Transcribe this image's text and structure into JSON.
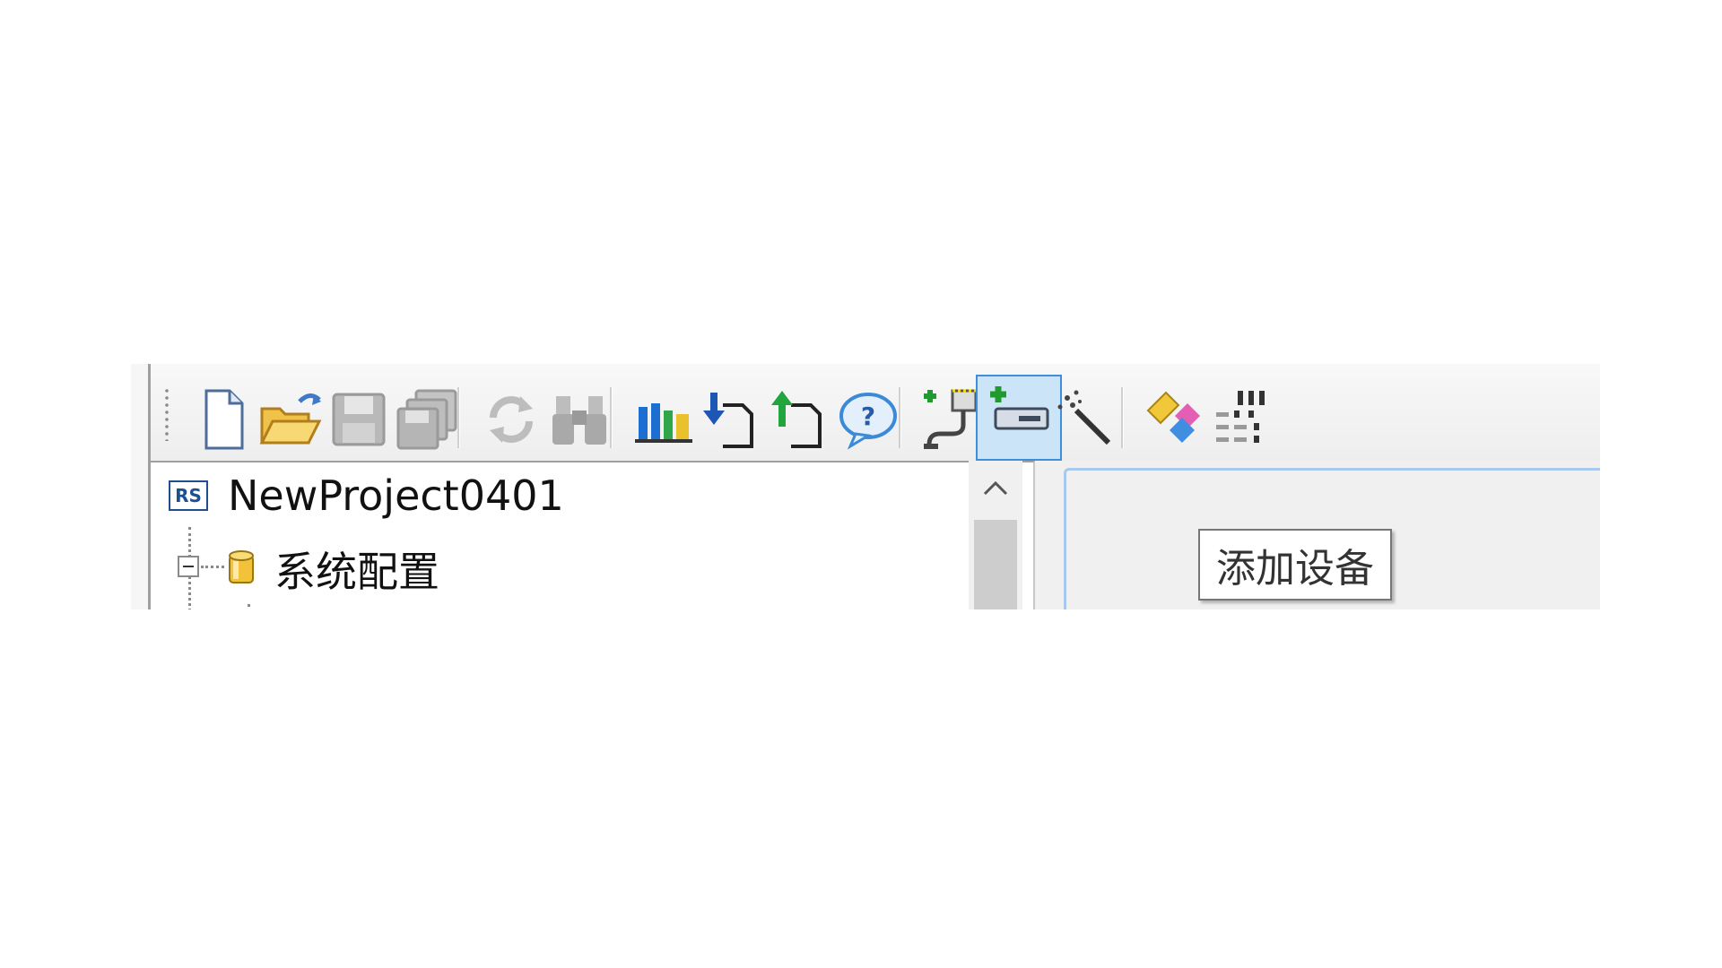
{
  "toolbar": {
    "buttons": [
      {
        "icon": "new-document-icon",
        "state": "enabled"
      },
      {
        "icon": "open-folder-icon",
        "state": "enabled"
      },
      {
        "icon": "save-icon",
        "state": "disabled"
      },
      {
        "icon": "save-all-icon",
        "state": "disabled"
      },
      {
        "icon": "refresh-icon",
        "state": "disabled"
      },
      {
        "icon": "find-binoculars-icon",
        "state": "disabled"
      },
      {
        "icon": "bar-chart-icon",
        "state": "enabled"
      },
      {
        "icon": "download-icon",
        "state": "enabled"
      },
      {
        "icon": "upload-icon",
        "state": "enabled"
      },
      {
        "icon": "help-icon",
        "state": "enabled"
      },
      {
        "icon": "add-connection-icon",
        "state": "enabled"
      },
      {
        "icon": "add-device-icon",
        "state": "hover"
      },
      {
        "icon": "wizard-wand-icon",
        "state": "enabled"
      },
      {
        "icon": "tag-diamond-icon",
        "state": "enabled"
      },
      {
        "icon": "grid-dots-icon",
        "state": "enabled"
      }
    ]
  },
  "tree": {
    "project": {
      "badge": "RS",
      "label": "NewProject0401"
    },
    "child": {
      "label": "系统配置"
    }
  },
  "tooltip": {
    "text": "添加设备"
  },
  "colors": {
    "hover_fill": "#cce4f7",
    "hover_border": "#3d8fdc",
    "panel_border": "#a9c8ee"
  }
}
